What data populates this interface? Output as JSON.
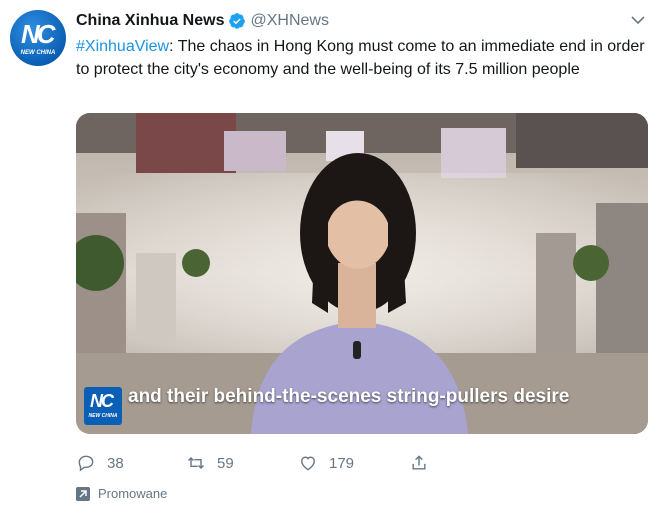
{
  "author": {
    "name": "China Xinhua News",
    "handle": "@XHNews",
    "avatar_mark": "NC",
    "avatar_sub": "NEW CHINA"
  },
  "tweet": {
    "hashtag": "#XinhuaView",
    "text": ": The chaos in Hong Kong must come to an immediate end in order to protect the city's economy and the well-being of its 7.5 million people"
  },
  "media": {
    "caption": "and their behind-the-scenes string-pullers desire",
    "logo_mark": "NC",
    "logo_sub": "NEW CHINA"
  },
  "actions": {
    "replies": "38",
    "retweets": "59",
    "likes": "179"
  },
  "promoted": {
    "label": "Promowane"
  },
  "icons": [
    "verified-icon",
    "chevron-down-icon",
    "reply-icon",
    "retweet-icon",
    "like-icon",
    "share-icon",
    "promoted-icon"
  ],
  "colors": {
    "link": "#1b95e0",
    "muted": "#657786",
    "verified": "#1da1f2"
  }
}
